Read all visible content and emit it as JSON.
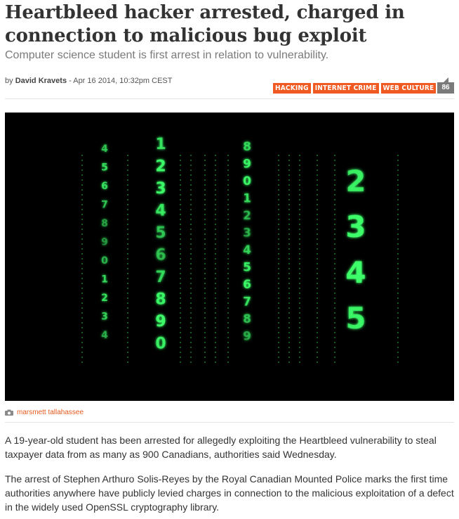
{
  "article": {
    "headline": "Heartbleed hacker arrested, charged in connection to malicious bug exploit",
    "dek": "Computer science student is first arrest in relation to vulnerability.",
    "byline_prefix": "by ",
    "author": "David Kravets",
    "date": " - Apr 16 2014, 10:32pm CEST",
    "tags": [
      "HACKING",
      "INTERNET CRIME",
      "WEB CULTURE"
    ],
    "comment_count": "86",
    "image": {
      "credit": "marsmett tallahassee",
      "columns": [
        [
          "4",
          "5",
          "6",
          "7",
          "8",
          "9",
          "0",
          "1",
          "2",
          "3",
          "4"
        ],
        [
          "1",
          "2",
          "3",
          "4",
          "5",
          "6",
          "7",
          "8",
          "9",
          "0"
        ],
        [
          "8",
          "9",
          "0",
          "1",
          "2",
          "3",
          "4",
          "5",
          "6",
          "7",
          "8",
          "9"
        ],
        [
          "2",
          "3",
          "4",
          "5"
        ]
      ]
    },
    "paragraphs": [
      "A 19-year-old student has been arrested for allegedly exploiting the Heartbleed vulnerability to steal taxpayer data from as many as 900 Canadians, authorities said Wednesday.",
      "The arrest of Stephen Arthuro Solis-Reyes by the Royal Canadian Mounted Police marks the first time authorities anywhere have publicly levied charges in connection to the malicious exploitation of a defect in the widely used OpenSSL cryptography library."
    ]
  },
  "colors": {
    "tag_bg": "#f05a22",
    "credit": "#e85a1e",
    "matrix_green": "#3dff6a"
  }
}
